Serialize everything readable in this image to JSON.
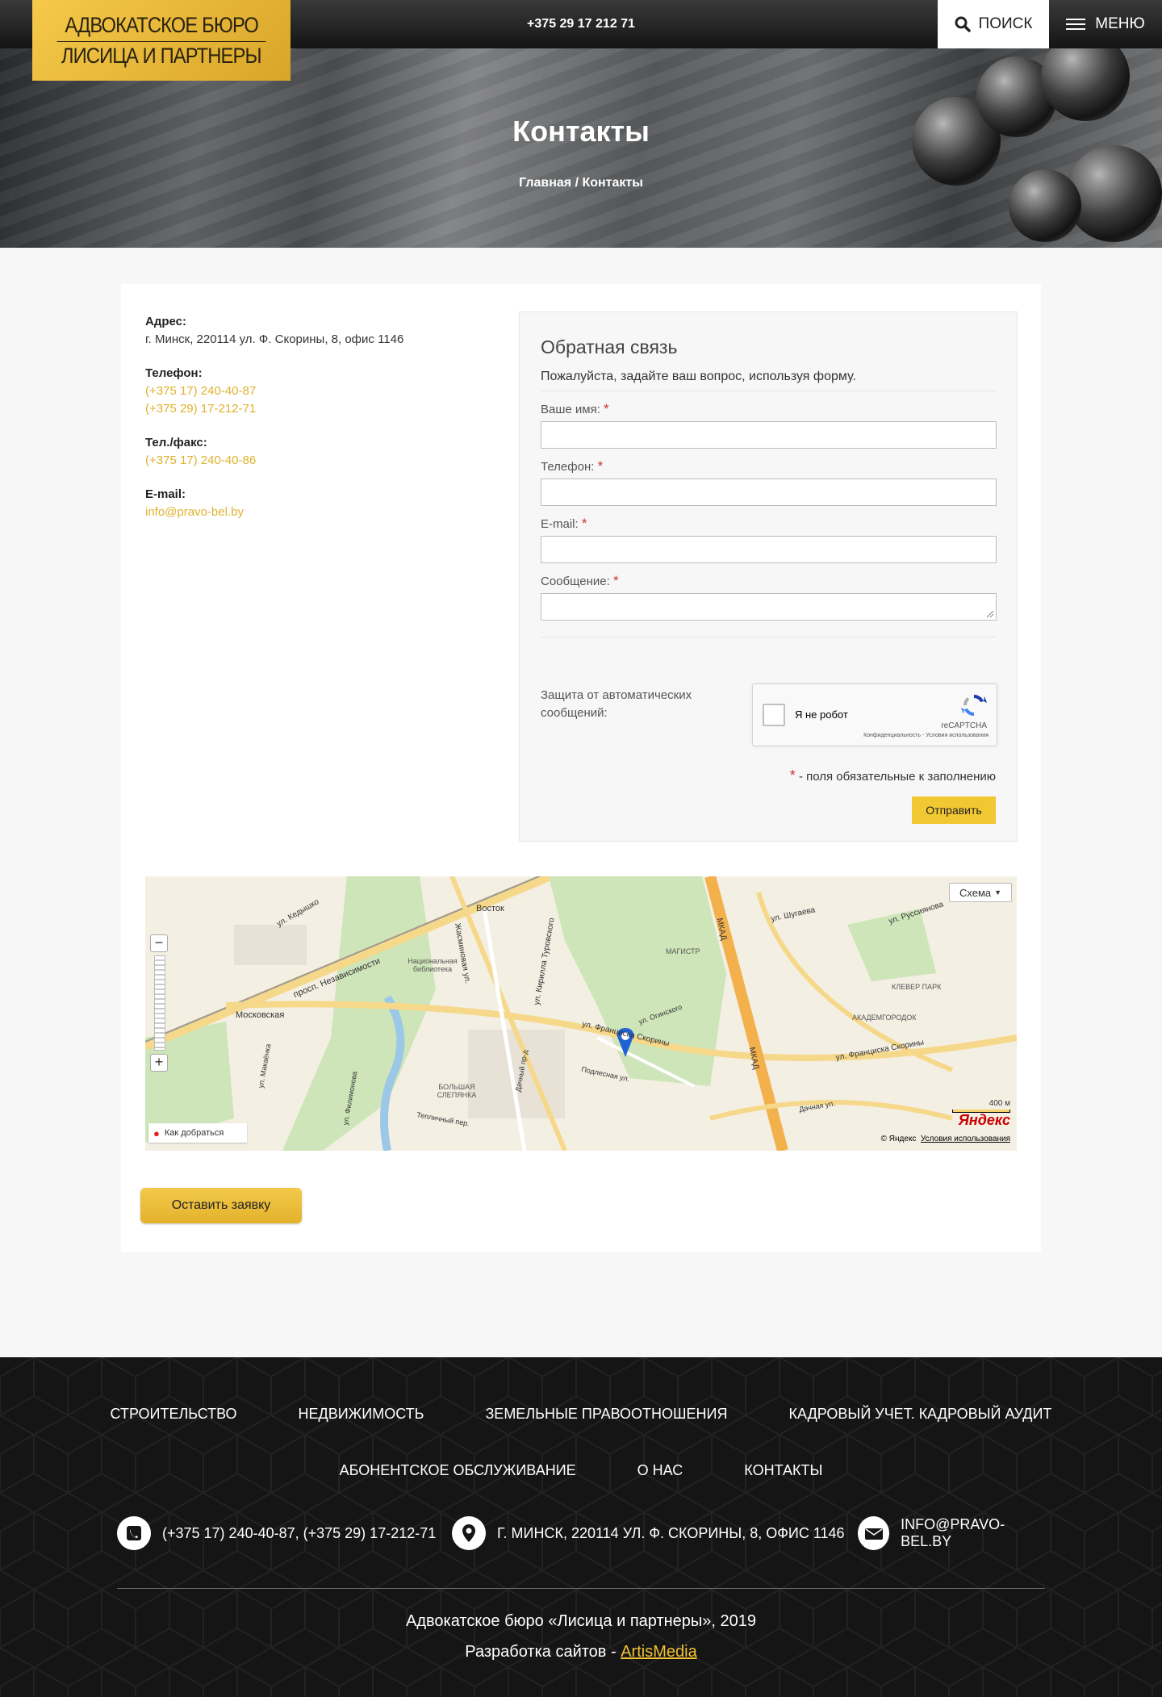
{
  "header": {
    "logo_line1": "АДВОКАТСКОЕ БЮРО",
    "logo_line2": "ЛИСИЦА И ПАРТНЕРЫ",
    "phone": "+375 29 17 212 71",
    "search_label": "ПОИСК",
    "menu_label": "МЕНЮ"
  },
  "hero": {
    "title": "Контакты",
    "breadcrumb": "Главная / Контакты"
  },
  "contacts": {
    "address_label": "Адрес:",
    "address": "г. Минск, 220114 ул. Ф. Скорины, 8, офис 1146",
    "phone_label": "Телефон:",
    "phone1": "(+375 17) 240-40-87",
    "phone2": "(+375 29) 17-212-71",
    "fax_label": "Тел./факс:",
    "fax": "(+375 17) 240-40-86",
    "email_label": "E-mail:",
    "email": "info@pravo-bel.by"
  },
  "form": {
    "title": "Обратная связь",
    "subtitle": "Пожалуйста, задайте ваш вопрос, используя форму.",
    "name_label": "Ваше имя:",
    "phone_label": "Телефон:",
    "email_label": "E-mail:",
    "message_label": "Сообщение:",
    "required_mark": "*",
    "protect_label": "Защита от автоматических сообщений:",
    "captcha_text": "Я не робот",
    "captcha_brand": "reCAPTCHA",
    "captcha_privacy": "Конфиденциальность - Условия использования",
    "required_note": " - поля обязательные к заполнению",
    "submit_label": "Отправить"
  },
  "map": {
    "type_selector": "Схема",
    "route_label": "Как добраться",
    "scale_label": "400 м",
    "brand": "Яндекс",
    "copyright": "© Яндекс",
    "terms": "Условия использования",
    "labels": {
      "vostok": "Восток",
      "moskovskaya": "Московская",
      "magistr": "МАГИСТР",
      "klever": "КЛЕВЕР ПАРК",
      "akadem": "АКАДЕМГОРОДОК",
      "mkad1": "МКАД",
      "mkad2": "МКАД",
      "library": "Национальная библиотека",
      "slepyanka": "БОЛЬШАЯ СЛЕПЯНКА",
      "nezav": "просп. Независимости",
      "skoriny1": "ул. Франциска Скорины",
      "skoriny2": "ул. Франциска Скорины",
      "shugaeva": "ул. Шугаева",
      "russiyanova": "ул. Руссиянова",
      "turovskogo": "ул. Кирилла Туровского",
      "zhudro": "Жасминовая ул.",
      "kedyshko": "ул. Кедышко",
      "podlesnaya": "Подлесная ул.",
      "dachnaya": "Дачная ул.",
      "teplichny": "Тепличный пер.",
      "filimonova": "ул. Филимонова",
      "makaenka": "ул. Макаёнка",
      "oginskogo": "ул. Огинского",
      "dachny_pr": "Дачный пр-д"
    }
  },
  "apply_label": "Оставить заявку",
  "footer": {
    "nav_row1": [
      "СТРОИТЕЛЬСТВО",
      "НЕДВИЖИМОСТЬ",
      "ЗЕМЕЛЬНЫЕ ПРАВООТНОШЕНИЯ",
      "КАДРОВЫЙ УЧЕТ. КАДРОВЫЙ АУДИТ"
    ],
    "nav_row2": [
      "АБОНЕНТСКОЕ ОБСЛУЖИВАНИЕ",
      "О НАС",
      "КОНТАКТЫ"
    ],
    "phones": "(+375 17) 240-40-87,  (+375 29) 17-212-71",
    "address": "Г. МИНСК, 220114 УЛ. Ф. СКОРИНЫ, 8, ОФИС 1146",
    "email": "INFO@PRAVO-BEL.BY",
    "copyright": "Адвокатское бюро «Лисица и партнеры», 2019",
    "dev_prefix": "Разработка сайтов - ",
    "dev_link": "ArtisMedia"
  },
  "colors": {
    "accent": "#f2c832",
    "link": "#e0b22e",
    "footer_bg": "#151515"
  }
}
